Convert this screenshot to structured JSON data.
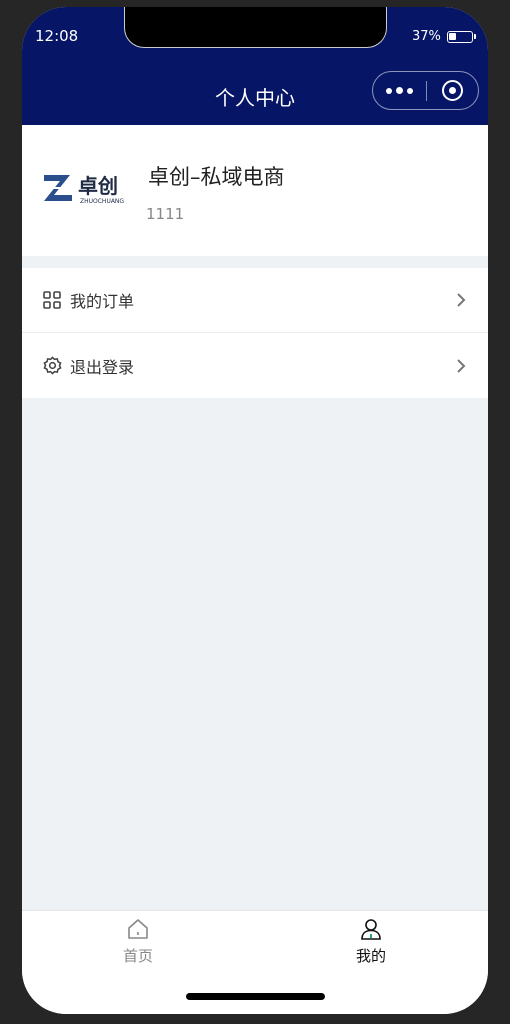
{
  "status_bar": {
    "time": "12:08",
    "battery": "37%",
    "battery_level": 0.37
  },
  "nav": {
    "title": "个人中心",
    "capsule_more_icon": "more-dots-icon",
    "capsule_close_icon": "target-close-icon"
  },
  "profile": {
    "logo_text_main": "卓创",
    "logo_text_sub": "ZHUOCHUANG",
    "name": "卓创–私域电商",
    "id": "1111"
  },
  "menu": {
    "items": [
      {
        "label": "我的订单",
        "icon": "grid-icon"
      },
      {
        "label": "退出登录",
        "icon": "gear-icon"
      }
    ]
  },
  "tabbar": {
    "items": [
      {
        "label": "首页",
        "icon": "home-icon",
        "active": false
      },
      {
        "label": "我的",
        "icon": "user-icon",
        "active": true
      }
    ]
  },
  "colors": {
    "header_bg": "#061566",
    "page_bg": "#eef2f5",
    "logo_blue": "#2b4f8c"
  }
}
